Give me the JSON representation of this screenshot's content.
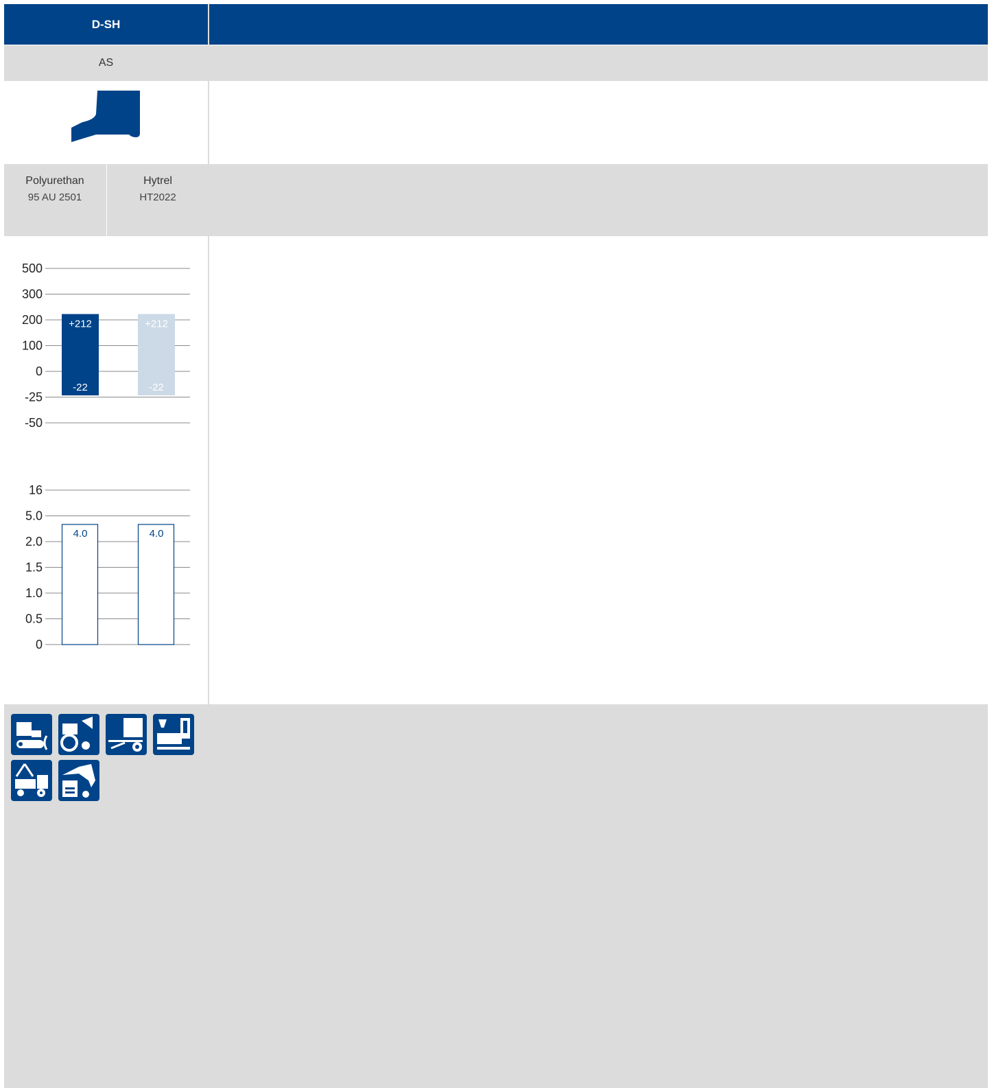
{
  "header": {
    "title": "D-SH"
  },
  "type_row": {
    "label": "AS"
  },
  "profile": {
    "icon": "seal-profile-icon",
    "color": "#004388"
  },
  "materials": [
    {
      "name": "Polyurethan",
      "code": "95 AU 2501"
    },
    {
      "name": "Hytrel",
      "code": "HT2022"
    }
  ],
  "chart_data": [
    {
      "type": "bar",
      "title": "",
      "ylabel": "",
      "tick_labels": [
        "500",
        "300",
        "200",
        "100",
        "0",
        "-25",
        "-50"
      ],
      "series": [
        {
          "name": "Polyurethan",
          "max": 212,
          "min": -22,
          "max_label": "+212",
          "min_label": "-22",
          "color": "#004388"
        },
        {
          "name": "Hytrel",
          "max": 212,
          "min": -22,
          "max_label": "+212",
          "min_label": "-22",
          "color": "#ccd9e6"
        }
      ]
    },
    {
      "type": "bar",
      "title": "",
      "ylabel": "",
      "tick_labels": [
        "16",
        "5.0",
        "2.0",
        "1.5",
        "1.0",
        "0.5",
        "0"
      ],
      "series": [
        {
          "name": "Polyurethan",
          "value": 4.0,
          "value_label": "4.0"
        },
        {
          "name": "Hytrel",
          "value": 4.0,
          "value_label": "4.0"
        }
      ]
    }
  ],
  "applications": [
    {
      "icon": "bulldozer-icon"
    },
    {
      "icon": "tractor-icon"
    },
    {
      "icon": "trailer-icon"
    },
    {
      "icon": "injection-molding-machine-icon"
    },
    {
      "icon": "truck-crane-icon"
    },
    {
      "icon": "excavator-icon"
    }
  ]
}
